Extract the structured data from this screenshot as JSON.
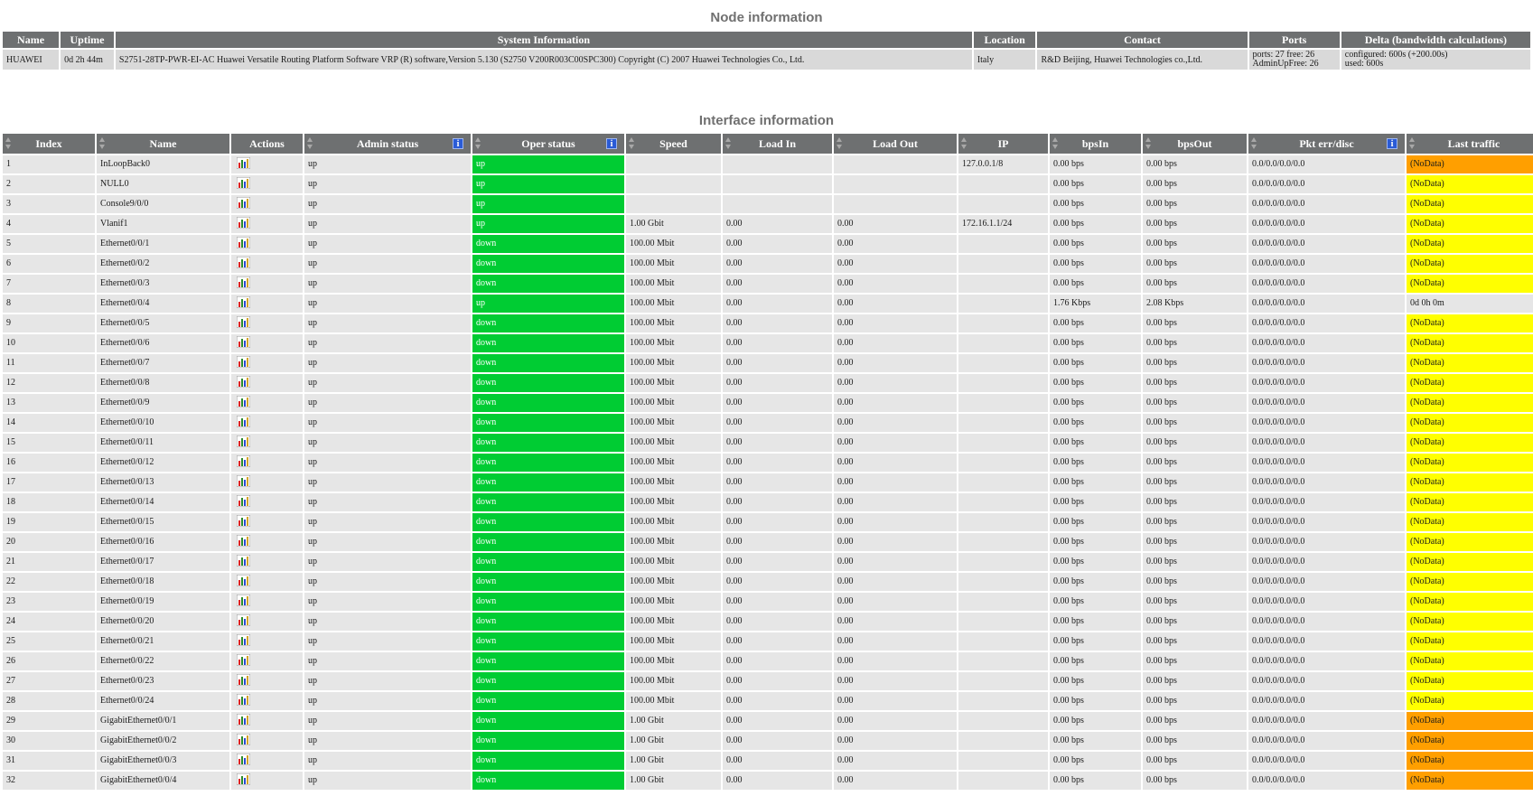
{
  "node_section": {
    "title": "Node information",
    "headers": [
      "Name",
      "Uptime",
      "System Information",
      "Location",
      "Contact",
      "Ports",
      "Delta (bandwidth calculations)"
    ],
    "row": {
      "name": "HUAWEI",
      "uptime": "0d 2h 44m",
      "system_info": "S2751-28TP-PWR-EI-AC Huawei Versatile Routing Platform Software VRP (R) software,Version 5.130 (S2750 V200R003C00SPC300) Copyright (C) 2007 Huawei Technologies Co., Ltd.",
      "location": "Italy",
      "contact": "R&D Beijing, Huawei Technologies co.,Ltd.",
      "ports_line1": "ports: 27 free: 26",
      "ports_line2": "AdminUpFree: 26",
      "delta_line1": "configured: 600s (+200.00s)",
      "delta_line2": "used: 600s"
    }
  },
  "interface_section": {
    "title": "Interface information",
    "headers": [
      "Index",
      "Name",
      "Actions",
      "Admin status",
      "Oper status",
      "Speed",
      "Load In",
      "Load Out",
      "IP",
      "bpsIn",
      "bpsOut",
      "Pkt err/disc",
      "Last traffic"
    ],
    "info_icon": "i",
    "rows": [
      {
        "index": "1",
        "name": "InLoopBack0",
        "admin": "up",
        "oper": "up",
        "speed": "",
        "load_in": "",
        "load_out": "",
        "ip": "127.0.0.1/8",
        "bps_in": "0.00 bps",
        "bps_out": "0.00 bps",
        "pkt": "0.0/0.0/0.0/0.0",
        "last": "(NoData)",
        "last_color": "orange"
      },
      {
        "index": "2",
        "name": "NULL0",
        "admin": "up",
        "oper": "up",
        "speed": "",
        "load_in": "",
        "load_out": "",
        "ip": "",
        "bps_in": "0.00 bps",
        "bps_out": "0.00 bps",
        "pkt": "0.0/0.0/0.0/0.0",
        "last": "(NoData)",
        "last_color": "yellow"
      },
      {
        "index": "3",
        "name": "Console9/0/0",
        "admin": "up",
        "oper": "up",
        "speed": "",
        "load_in": "",
        "load_out": "",
        "ip": "",
        "bps_in": "0.00 bps",
        "bps_out": "0.00 bps",
        "pkt": "0.0/0.0/0.0/0.0",
        "last": "(NoData)",
        "last_color": "yellow"
      },
      {
        "index": "4",
        "name": "Vlanif1",
        "admin": "up",
        "oper": "up",
        "speed": "1.00 Gbit",
        "load_in": "0.00",
        "load_out": "0.00",
        "ip": "172.16.1.1/24",
        "bps_in": "0.00 bps",
        "bps_out": "0.00 bps",
        "pkt": "0.0/0.0/0.0/0.0",
        "last": "(NoData)",
        "last_color": "yellow"
      },
      {
        "index": "5",
        "name": "Ethernet0/0/1",
        "admin": "up",
        "oper": "down",
        "speed": "100.00 Mbit",
        "load_in": "0.00",
        "load_out": "0.00",
        "ip": "",
        "bps_in": "0.00 bps",
        "bps_out": "0.00 bps",
        "pkt": "0.0/0.0/0.0/0.0",
        "last": "(NoData)",
        "last_color": "yellow"
      },
      {
        "index": "6",
        "name": "Ethernet0/0/2",
        "admin": "up",
        "oper": "down",
        "speed": "100.00 Mbit",
        "load_in": "0.00",
        "load_out": "0.00",
        "ip": "",
        "bps_in": "0.00 bps",
        "bps_out": "0.00 bps",
        "pkt": "0.0/0.0/0.0/0.0",
        "last": "(NoData)",
        "last_color": "yellow"
      },
      {
        "index": "7",
        "name": "Ethernet0/0/3",
        "admin": "up",
        "oper": "down",
        "speed": "100.00 Mbit",
        "load_in": "0.00",
        "load_out": "0.00",
        "ip": "",
        "bps_in": "0.00 bps",
        "bps_out": "0.00 bps",
        "pkt": "0.0/0.0/0.0/0.0",
        "last": "(NoData)",
        "last_color": "yellow"
      },
      {
        "index": "8",
        "name": "Ethernet0/0/4",
        "admin": "up",
        "oper": "up",
        "speed": "100.00 Mbit",
        "load_in": "0.00",
        "load_out": "0.00",
        "ip": "",
        "bps_in": "1.76 Kbps",
        "bps_out": "2.08 Kbps",
        "pkt": "0.0/0.0/0.0/0.0",
        "last": "0d 0h 0m",
        "last_color": "none"
      },
      {
        "index": "9",
        "name": "Ethernet0/0/5",
        "admin": "up",
        "oper": "down",
        "speed": "100.00 Mbit",
        "load_in": "0.00",
        "load_out": "0.00",
        "ip": "",
        "bps_in": "0.00 bps",
        "bps_out": "0.00 bps",
        "pkt": "0.0/0.0/0.0/0.0",
        "last": "(NoData)",
        "last_color": "yellow"
      },
      {
        "index": "10",
        "name": "Ethernet0/0/6",
        "admin": "up",
        "oper": "down",
        "speed": "100.00 Mbit",
        "load_in": "0.00",
        "load_out": "0.00",
        "ip": "",
        "bps_in": "0.00 bps",
        "bps_out": "0.00 bps",
        "pkt": "0.0/0.0/0.0/0.0",
        "last": "(NoData)",
        "last_color": "yellow"
      },
      {
        "index": "11",
        "name": "Ethernet0/0/7",
        "admin": "up",
        "oper": "down",
        "speed": "100.00 Mbit",
        "load_in": "0.00",
        "load_out": "0.00",
        "ip": "",
        "bps_in": "0.00 bps",
        "bps_out": "0.00 bps",
        "pkt": "0.0/0.0/0.0/0.0",
        "last": "(NoData)",
        "last_color": "yellow"
      },
      {
        "index": "12",
        "name": "Ethernet0/0/8",
        "admin": "up",
        "oper": "down",
        "speed": "100.00 Mbit",
        "load_in": "0.00",
        "load_out": "0.00",
        "ip": "",
        "bps_in": "0.00 bps",
        "bps_out": "0.00 bps",
        "pkt": "0.0/0.0/0.0/0.0",
        "last": "(NoData)",
        "last_color": "yellow"
      },
      {
        "index": "13",
        "name": "Ethernet0/0/9",
        "admin": "up",
        "oper": "down",
        "speed": "100.00 Mbit",
        "load_in": "0.00",
        "load_out": "0.00",
        "ip": "",
        "bps_in": "0.00 bps",
        "bps_out": "0.00 bps",
        "pkt": "0.0/0.0/0.0/0.0",
        "last": "(NoData)",
        "last_color": "yellow"
      },
      {
        "index": "14",
        "name": "Ethernet0/0/10",
        "admin": "up",
        "oper": "down",
        "speed": "100.00 Mbit",
        "load_in": "0.00",
        "load_out": "0.00",
        "ip": "",
        "bps_in": "0.00 bps",
        "bps_out": "0.00 bps",
        "pkt": "0.0/0.0/0.0/0.0",
        "last": "(NoData)",
        "last_color": "yellow"
      },
      {
        "index": "15",
        "name": "Ethernet0/0/11",
        "admin": "up",
        "oper": "down",
        "speed": "100.00 Mbit",
        "load_in": "0.00",
        "load_out": "0.00",
        "ip": "",
        "bps_in": "0.00 bps",
        "bps_out": "0.00 bps",
        "pkt": "0.0/0.0/0.0/0.0",
        "last": "(NoData)",
        "last_color": "yellow"
      },
      {
        "index": "16",
        "name": "Ethernet0/0/12",
        "admin": "up",
        "oper": "down",
        "speed": "100.00 Mbit",
        "load_in": "0.00",
        "load_out": "0.00",
        "ip": "",
        "bps_in": "0.00 bps",
        "bps_out": "0.00 bps",
        "pkt": "0.0/0.0/0.0/0.0",
        "last": "(NoData)",
        "last_color": "yellow"
      },
      {
        "index": "17",
        "name": "Ethernet0/0/13",
        "admin": "up",
        "oper": "down",
        "speed": "100.00 Mbit",
        "load_in": "0.00",
        "load_out": "0.00",
        "ip": "",
        "bps_in": "0.00 bps",
        "bps_out": "0.00 bps",
        "pkt": "0.0/0.0/0.0/0.0",
        "last": "(NoData)",
        "last_color": "yellow"
      },
      {
        "index": "18",
        "name": "Ethernet0/0/14",
        "admin": "up",
        "oper": "down",
        "speed": "100.00 Mbit",
        "load_in": "0.00",
        "load_out": "0.00",
        "ip": "",
        "bps_in": "0.00 bps",
        "bps_out": "0.00 bps",
        "pkt": "0.0/0.0/0.0/0.0",
        "last": "(NoData)",
        "last_color": "yellow"
      },
      {
        "index": "19",
        "name": "Ethernet0/0/15",
        "admin": "up",
        "oper": "down",
        "speed": "100.00 Mbit",
        "load_in": "0.00",
        "load_out": "0.00",
        "ip": "",
        "bps_in": "0.00 bps",
        "bps_out": "0.00 bps",
        "pkt": "0.0/0.0/0.0/0.0",
        "last": "(NoData)",
        "last_color": "yellow"
      },
      {
        "index": "20",
        "name": "Ethernet0/0/16",
        "admin": "up",
        "oper": "down",
        "speed": "100.00 Mbit",
        "load_in": "0.00",
        "load_out": "0.00",
        "ip": "",
        "bps_in": "0.00 bps",
        "bps_out": "0.00 bps",
        "pkt": "0.0/0.0/0.0/0.0",
        "last": "(NoData)",
        "last_color": "yellow"
      },
      {
        "index": "21",
        "name": "Ethernet0/0/17",
        "admin": "up",
        "oper": "down",
        "speed": "100.00 Mbit",
        "load_in": "0.00",
        "load_out": "0.00",
        "ip": "",
        "bps_in": "0.00 bps",
        "bps_out": "0.00 bps",
        "pkt": "0.0/0.0/0.0/0.0",
        "last": "(NoData)",
        "last_color": "yellow"
      },
      {
        "index": "22",
        "name": "Ethernet0/0/18",
        "admin": "up",
        "oper": "down",
        "speed": "100.00 Mbit",
        "load_in": "0.00",
        "load_out": "0.00",
        "ip": "",
        "bps_in": "0.00 bps",
        "bps_out": "0.00 bps",
        "pkt": "0.0/0.0/0.0/0.0",
        "last": "(NoData)",
        "last_color": "yellow"
      },
      {
        "index": "23",
        "name": "Ethernet0/0/19",
        "admin": "up",
        "oper": "down",
        "speed": "100.00 Mbit",
        "load_in": "0.00",
        "load_out": "0.00",
        "ip": "",
        "bps_in": "0.00 bps",
        "bps_out": "0.00 bps",
        "pkt": "0.0/0.0/0.0/0.0",
        "last": "(NoData)",
        "last_color": "yellow"
      },
      {
        "index": "24",
        "name": "Ethernet0/0/20",
        "admin": "up",
        "oper": "down",
        "speed": "100.00 Mbit",
        "load_in": "0.00",
        "load_out": "0.00",
        "ip": "",
        "bps_in": "0.00 bps",
        "bps_out": "0.00 bps",
        "pkt": "0.0/0.0/0.0/0.0",
        "last": "(NoData)",
        "last_color": "yellow"
      },
      {
        "index": "25",
        "name": "Ethernet0/0/21",
        "admin": "up",
        "oper": "down",
        "speed": "100.00 Mbit",
        "load_in": "0.00",
        "load_out": "0.00",
        "ip": "",
        "bps_in": "0.00 bps",
        "bps_out": "0.00 bps",
        "pkt": "0.0/0.0/0.0/0.0",
        "last": "(NoData)",
        "last_color": "yellow"
      },
      {
        "index": "26",
        "name": "Ethernet0/0/22",
        "admin": "up",
        "oper": "down",
        "speed": "100.00 Mbit",
        "load_in": "0.00",
        "load_out": "0.00",
        "ip": "",
        "bps_in": "0.00 bps",
        "bps_out": "0.00 bps",
        "pkt": "0.0/0.0/0.0/0.0",
        "last": "(NoData)",
        "last_color": "yellow"
      },
      {
        "index": "27",
        "name": "Ethernet0/0/23",
        "admin": "up",
        "oper": "down",
        "speed": "100.00 Mbit",
        "load_in": "0.00",
        "load_out": "0.00",
        "ip": "",
        "bps_in": "0.00 bps",
        "bps_out": "0.00 bps",
        "pkt": "0.0/0.0/0.0/0.0",
        "last": "(NoData)",
        "last_color": "yellow"
      },
      {
        "index": "28",
        "name": "Ethernet0/0/24",
        "admin": "up",
        "oper": "down",
        "speed": "100.00 Mbit",
        "load_in": "0.00",
        "load_out": "0.00",
        "ip": "",
        "bps_in": "0.00 bps",
        "bps_out": "0.00 bps",
        "pkt": "0.0/0.0/0.0/0.0",
        "last": "(NoData)",
        "last_color": "yellow"
      },
      {
        "index": "29",
        "name": "GigabitEthernet0/0/1",
        "admin": "up",
        "oper": "down",
        "speed": "1.00 Gbit",
        "load_in": "0.00",
        "load_out": "0.00",
        "ip": "",
        "bps_in": "0.00 bps",
        "bps_out": "0.00 bps",
        "pkt": "0.0/0.0/0.0/0.0",
        "last": "(NoData)",
        "last_color": "orange"
      },
      {
        "index": "30",
        "name": "GigabitEthernet0/0/2",
        "admin": "up",
        "oper": "down",
        "speed": "1.00 Gbit",
        "load_in": "0.00",
        "load_out": "0.00",
        "ip": "",
        "bps_in": "0.00 bps",
        "bps_out": "0.00 bps",
        "pkt": "0.0/0.0/0.0/0.0",
        "last": "(NoData)",
        "last_color": "orange"
      },
      {
        "index": "31",
        "name": "GigabitEthernet0/0/3",
        "admin": "up",
        "oper": "down",
        "speed": "1.00 Gbit",
        "load_in": "0.00",
        "load_out": "0.00",
        "ip": "",
        "bps_in": "0.00 bps",
        "bps_out": "0.00 bps",
        "pkt": "0.0/0.0/0.0/0.0",
        "last": "(NoData)",
        "last_color": "orange"
      },
      {
        "index": "32",
        "name": "GigabitEthernet0/0/4",
        "admin": "up",
        "oper": "down",
        "speed": "1.00 Gbit",
        "load_in": "0.00",
        "load_out": "0.00",
        "ip": "",
        "bps_in": "0.00 bps",
        "bps_out": "0.00 bps",
        "pkt": "0.0/0.0/0.0/0.0",
        "last": "(NoData)",
        "last_color": "orange"
      }
    ]
  },
  "colors": {
    "header_bg": "#6e7071",
    "oper_status_bg": "#00cc33",
    "last_traffic_yellow": "#ffff00",
    "last_traffic_orange": "#ff9f00",
    "row_bg": "#e6e6e6"
  },
  "icons": {
    "action_icon": "bar-chart-icon",
    "sort_icon": "sort-arrows-icon",
    "info_icon": "info-icon"
  }
}
